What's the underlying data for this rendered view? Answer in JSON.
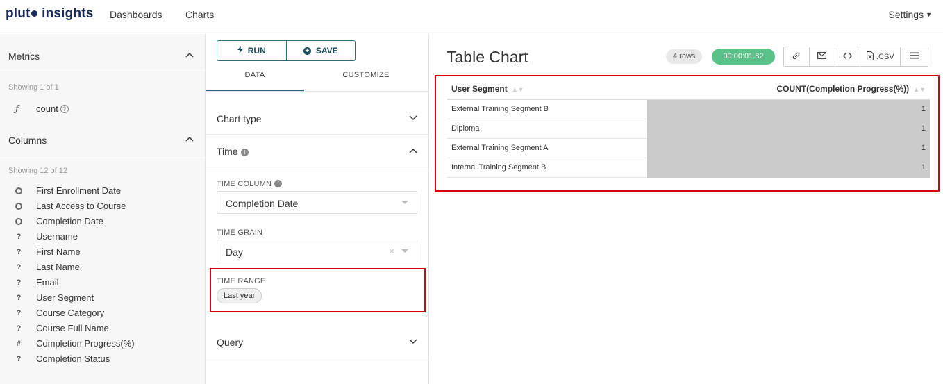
{
  "topnav": {
    "logo_part1": "plut",
    "logo_part2": "insights",
    "links": [
      "Dashboards",
      "Charts"
    ],
    "settings": "Settings"
  },
  "sidebar": {
    "metrics": {
      "title": "Metrics",
      "showing": "Showing 1 of 1",
      "items": [
        {
          "icon": "function-icon",
          "label": "count"
        }
      ]
    },
    "columns": {
      "title": "Columns",
      "showing": "Showing 12 of 12",
      "items": [
        {
          "icon": "clock-icon",
          "label": "First Enrollment Date"
        },
        {
          "icon": "clock-icon",
          "label": "Last Access to Course"
        },
        {
          "icon": "clock-icon",
          "label": "Completion Date"
        },
        {
          "icon": "question-icon",
          "label": "Username"
        },
        {
          "icon": "question-icon",
          "label": "First Name"
        },
        {
          "icon": "question-icon",
          "label": "Last Name"
        },
        {
          "icon": "question-icon",
          "label": "Email"
        },
        {
          "icon": "question-icon",
          "label": "User Segment"
        },
        {
          "icon": "question-icon",
          "label": "Course Category"
        },
        {
          "icon": "question-icon",
          "label": "Course Full Name"
        },
        {
          "icon": "hash-icon",
          "label": "Completion Progress(%)"
        },
        {
          "icon": "question-icon",
          "label": "Completion Status"
        }
      ]
    }
  },
  "editor": {
    "run_label": "RUN",
    "save_label": "SAVE",
    "tabs": [
      "DATA",
      "CUSTOMIZE"
    ],
    "active_tab": "DATA",
    "sections": {
      "chart_type": "Chart type",
      "time": "Time",
      "query": "Query"
    },
    "time_column": {
      "label": "TIME COLUMN",
      "value": "Completion Date"
    },
    "time_grain": {
      "label": "TIME GRAIN",
      "value": "Day"
    },
    "time_range": {
      "label": "TIME RANGE",
      "value": "Last year"
    }
  },
  "result": {
    "title": "Table Chart",
    "rows_badge": "4 rows",
    "elapsed": "00:00:01.82",
    "toolbar": {
      "csv_label": ".CSV"
    },
    "accent_color": "#5ac189",
    "highlight_color": "#d9000d",
    "table": {
      "columns": [
        "User Segment",
        "COUNT(Completion Progress(%))"
      ],
      "rows": [
        [
          "External Training Segment B",
          "1"
        ],
        [
          "Diploma",
          "1"
        ],
        [
          "External Training Segment A",
          "1"
        ],
        [
          "Internal Training Segment B",
          "1"
        ]
      ]
    }
  }
}
